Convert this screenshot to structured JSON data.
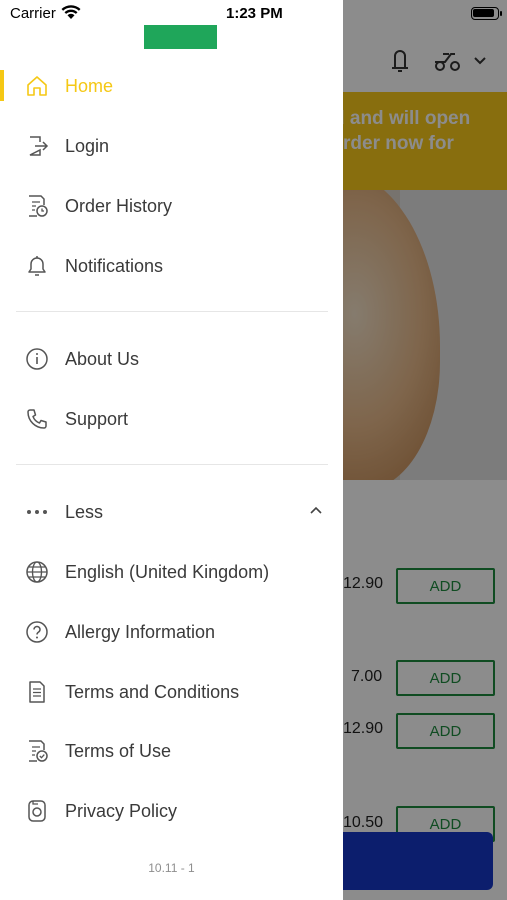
{
  "status_bar": {
    "carrier": "Carrier",
    "time": "1:23 PM"
  },
  "background": {
    "banner_line1": "d and will open",
    "banner_line2": "rder now for",
    "items": [
      {
        "price": "12.90",
        "add_label": "ADD"
      },
      {
        "price": "7.00",
        "add_label": "ADD"
      },
      {
        "price": "12.90",
        "add_label": "ADD"
      },
      {
        "price": "10.50",
        "add_label": "ADD"
      }
    ]
  },
  "drawer": {
    "menu_primary": [
      {
        "label": "Home",
        "icon": "home-icon",
        "active": true
      },
      {
        "label": "Login",
        "icon": "login-icon"
      },
      {
        "label": "Order History",
        "icon": "order-history-icon"
      },
      {
        "label": "Notifications",
        "icon": "bell-icon"
      }
    ],
    "menu_secondary": [
      {
        "label": "About Us",
        "icon": "info-icon"
      },
      {
        "label": "Support",
        "icon": "phone-icon"
      }
    ],
    "menu_more": [
      {
        "label": "Less",
        "icon": "more-dots-icon"
      },
      {
        "label": "English (United Kingdom)",
        "icon": "globe-icon"
      },
      {
        "label": "Allergy Information",
        "icon": "question-icon"
      },
      {
        "label": "Terms and Conditions",
        "icon": "document-icon"
      },
      {
        "label": "Terms of Use",
        "icon": "document-check-icon"
      },
      {
        "label": "Privacy Policy",
        "icon": "privacy-icon"
      }
    ],
    "version": "10.11 - 1"
  },
  "colors": {
    "accent": "#f5c815",
    "text": "#3a3a3a",
    "logo": "#1fa65a",
    "add_button": "#1e8a3e",
    "cta": "#1637c7"
  }
}
